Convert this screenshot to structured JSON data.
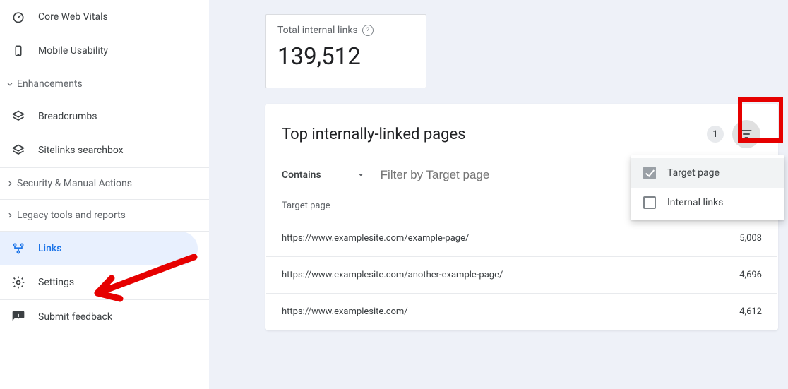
{
  "sidebar": {
    "core_web_vitals": "Core Web Vitals",
    "mobile_usability": "Mobile Usability",
    "enhancements": "Enhancements",
    "breadcrumbs": "Breadcrumbs",
    "sitelinks_searchbox": "Sitelinks searchbox",
    "security_manual": "Security & Manual Actions",
    "legacy_tools": "Legacy tools and reports",
    "links": "Links",
    "settings": "Settings",
    "submit_feedback": "Submit feedback"
  },
  "stat": {
    "label": "Total internal links",
    "value": "139,512"
  },
  "main": {
    "title": "Top internally-linked pages",
    "filter_count": "1",
    "contains_label": "Contains",
    "filter_placeholder": "Filter by Target page",
    "column_label": "Target page",
    "rows": [
      {
        "url": "https://www.examplesite.com/example-page/",
        "count": "5,008"
      },
      {
        "url": "https://www.examplesite.com/another-example-page/",
        "count": "4,696"
      },
      {
        "url": "https://www.examplesite.com/",
        "count": "4,612"
      }
    ],
    "popover": {
      "target_page": "Target page",
      "internal_links": "Internal links"
    }
  }
}
